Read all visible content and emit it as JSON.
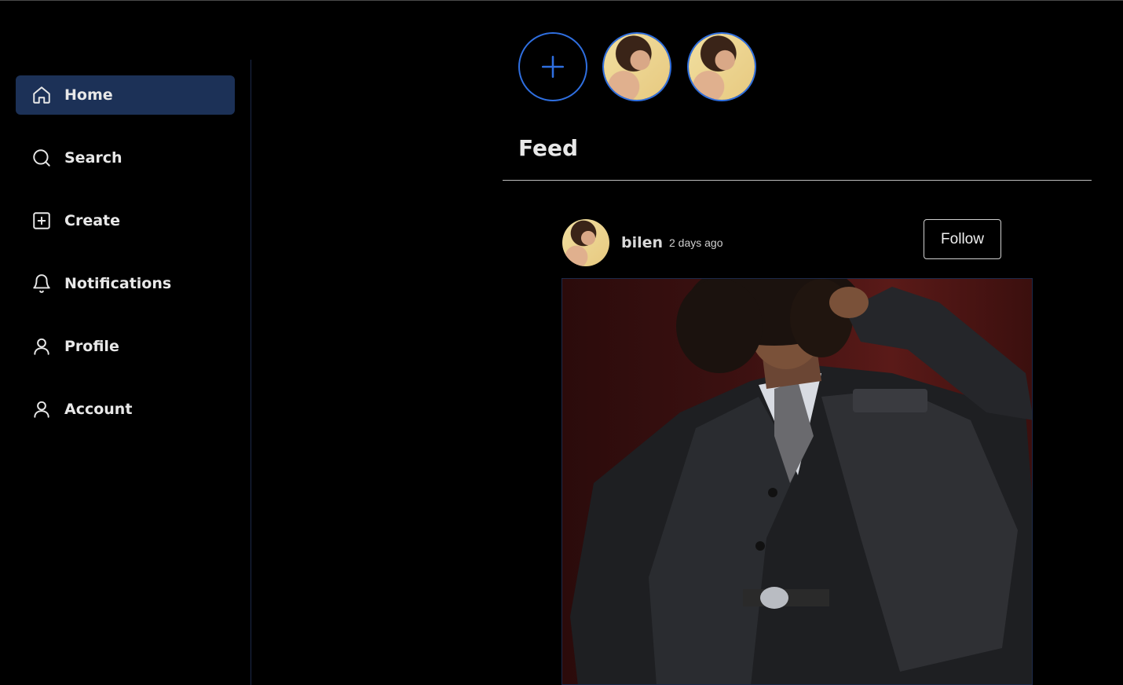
{
  "sidebar": {
    "items": [
      {
        "label": "Home",
        "icon": "home-icon",
        "active": true
      },
      {
        "label": "Search",
        "icon": "search-icon",
        "active": false
      },
      {
        "label": "Create",
        "icon": "plus-square-icon",
        "active": false
      },
      {
        "label": "Notifications",
        "icon": "bell-icon",
        "active": false
      },
      {
        "label": "Profile",
        "icon": "user-icon",
        "active": false
      },
      {
        "label": "Account",
        "icon": "user-icon",
        "active": false
      }
    ],
    "active_color": "#1c3157"
  },
  "stories": {
    "add_icon": "plus-icon",
    "accent_color": "#2f6fe0"
  },
  "feed": {
    "title": "Feed",
    "post": {
      "username": "bilen",
      "time": "2 days ago",
      "follow_label": "Follow"
    }
  }
}
